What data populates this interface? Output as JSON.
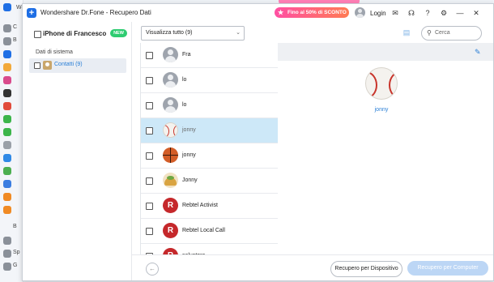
{
  "background_app": {
    "title_fragment": "Wo",
    "sidebar_letters": [
      "C",
      "B",
      "B",
      "Sp",
      "G"
    ]
  },
  "window": {
    "title": "Wondershare Dr.Fone - Recupero Dati",
    "promo": "Fino al 50% di SCONTO",
    "login": "Login",
    "icons": [
      "mail-icon",
      "headset-icon",
      "help-icon",
      "settings-icon",
      "minimize-icon",
      "close-icon"
    ]
  },
  "left_panel": {
    "device_name": "iPhone di Francesco",
    "new_badge": "NEW",
    "section_title": "Dati di sistema",
    "items": [
      {
        "label": "Contatti (9)"
      }
    ]
  },
  "toolbar": {
    "view_select_value": "Visualizza tutto (9)",
    "search_placeholder": "Cerca"
  },
  "contacts": [
    {
      "name": "Fra",
      "avatar": "generic"
    },
    {
      "name": "lo",
      "avatar": "generic"
    },
    {
      "name": "lo",
      "avatar": "generic"
    },
    {
      "name": "jonny",
      "avatar": "baseball",
      "selected": true
    },
    {
      "name": "jonny",
      "avatar": "basketball"
    },
    {
      "name": "Jonny",
      "avatar": "taco"
    },
    {
      "name": "Rebtel Activist",
      "avatar": "rebtel"
    },
    {
      "name": "Rebtel Local Call",
      "avatar": "rebtel"
    },
    {
      "name": "salvatore",
      "avatar": "rebtel"
    }
  ],
  "detail": {
    "name": "jonny"
  },
  "footer": {
    "device_button": "Recupero per Dispositivo",
    "computer_button": "Recupero per Computer"
  },
  "colors": {
    "accent": "#2a7fd6",
    "selected_row": "#cde8f8",
    "new_badge": "#2ecc71",
    "promo_start": "#ff4fa3",
    "promo_end": "#ff7b53"
  }
}
